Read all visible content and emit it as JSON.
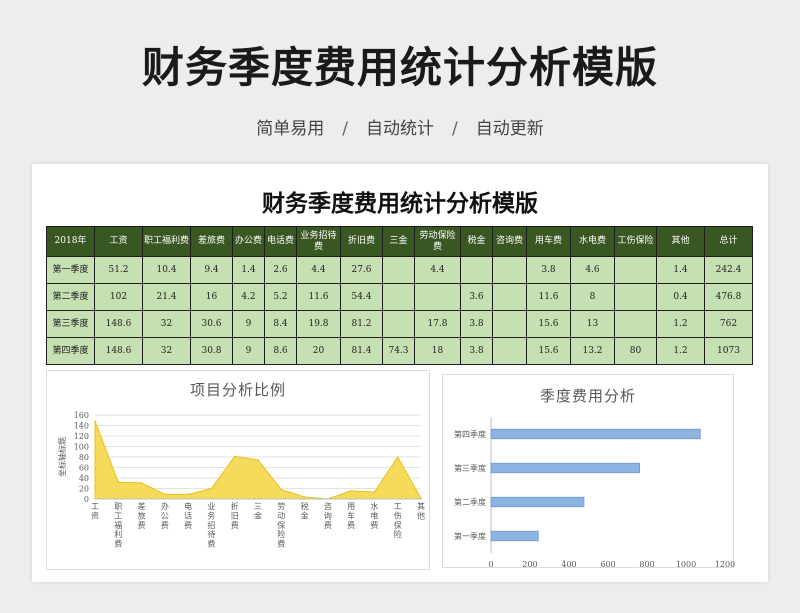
{
  "hero": {
    "title": "财务季度费用统计分析模版",
    "tags": [
      "简单易用",
      "自动统计",
      "自动更新"
    ],
    "separator": "/"
  },
  "sheet": {
    "title": "财务季度费用统计分析模版",
    "table": {
      "headers": [
        "2018年",
        "工资",
        "职工福利费",
        "差旅费",
        "办公费",
        "电话费",
        "业务招待费",
        "折旧费",
        "三金",
        "劳动保险费",
        "税金",
        "咨询费",
        "用车费",
        "水电费",
        "工伤保险",
        "其他",
        "总计"
      ],
      "rows": [
        [
          "第一季度",
          "51.2",
          "10.4",
          "9.4",
          "1.4",
          "2.6",
          "4.4",
          "27.6",
          "",
          "4.4",
          "",
          "",
          "3.8",
          "4.6",
          "",
          "1.4",
          "242.4"
        ],
        [
          "第二季度",
          "102",
          "21.4",
          "16",
          "4.2",
          "5.2",
          "11.6",
          "54.4",
          "",
          "",
          "3.6",
          "",
          "11.6",
          "8",
          "",
          "0.4",
          "476.8"
        ],
        [
          "第三季度",
          "148.6",
          "32",
          "30.6",
          "9",
          "8.4",
          "19.8",
          "81.2",
          "",
          "17.8",
          "3.8",
          "",
          "15.6",
          "13",
          "",
          "1.2",
          "762"
        ],
        [
          "第四季度",
          "148.6",
          "32",
          "30.8",
          "9",
          "8.6",
          "20",
          "81.4",
          "74.3",
          "18",
          "3.8",
          "",
          "15.6",
          "13.2",
          "80",
          "1.2",
          "1073"
        ]
      ]
    }
  },
  "colors": {
    "header_bg": "#385723",
    "cell_bg": "#c5e0b3",
    "area_fill": "#f5d33f",
    "bar_fill": "#8db3e2"
  },
  "chart_data": [
    {
      "type": "area",
      "title": "项目分析比例",
      "ylabel": "坐标轴标题",
      "categories": [
        "工资",
        "职工福利费",
        "差旅费",
        "办公费",
        "电话费",
        "业务招待费",
        "折旧费",
        "三金",
        "劳动保险费",
        "税金",
        "咨询费",
        "用车费",
        "水电费",
        "工伤保险",
        "其他"
      ],
      "values": [
        148.6,
        32,
        30.8,
        9,
        8.6,
        20,
        81.4,
        74.3,
        18,
        3.8,
        0,
        15.6,
        13.2,
        80,
        1.2
      ],
      "ylim": [
        0,
        160
      ],
      "yticks": [
        0,
        20,
        40,
        60,
        80,
        100,
        120,
        140,
        160
      ],
      "grid": true
    },
    {
      "type": "bar",
      "orientation": "horizontal",
      "title": "季度费用分析",
      "categories": [
        "第一季度",
        "第二季度",
        "第三季度",
        "第四季度"
      ],
      "values": [
        242.4,
        476.8,
        762,
        1073
      ],
      "xlim": [
        0,
        1200
      ],
      "xticks": [
        0,
        200,
        400,
        600,
        800,
        1000,
        1200
      ],
      "grid": false
    }
  ]
}
